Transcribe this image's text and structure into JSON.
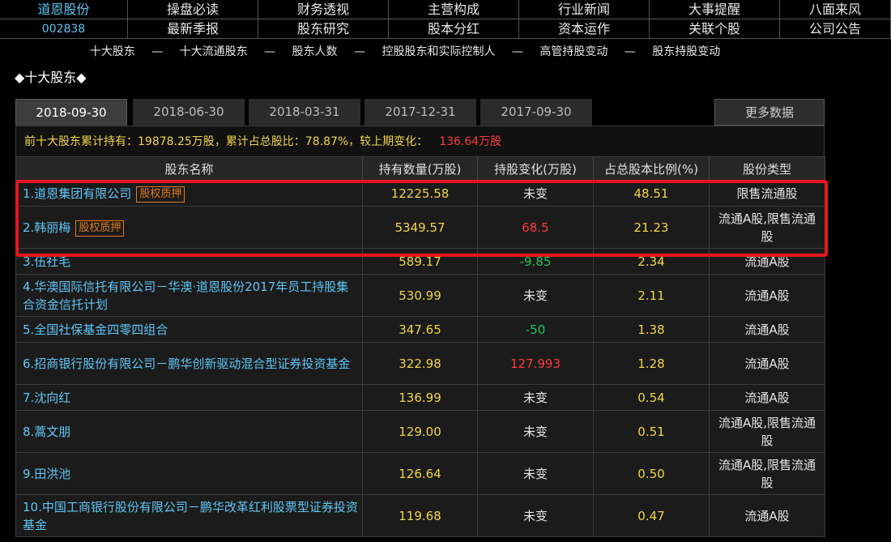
{
  "stock": {
    "name": "道恩股份",
    "code": "002838"
  },
  "topnav": {
    "row1": [
      "操盘必读",
      "财务透视",
      "主营构成",
      "行业新闻",
      "大事提醒",
      "八面来风"
    ],
    "row2": [
      "最新季报",
      "股东研究",
      "股本分红",
      "资本运作",
      "关联个股",
      "公司公告"
    ]
  },
  "subnav": [
    "十大股东",
    "十大流通股东",
    "股东人数",
    "控股股东和实际控制人",
    "高管持股变动",
    "股东持股变动"
  ],
  "subnav_sep": "—",
  "section_title": "◆十大股东◆",
  "tabs": [
    "2018-09-30",
    "2018-06-30",
    "2018-03-31",
    "2017-12-31",
    "2017-09-30"
  ],
  "more_label": "更多数据",
  "summary": {
    "text": "前十大股东累计持有：19878.25万股，累计占总股比：78.87%，较上期变化：",
    "change": "136.64万股"
  },
  "columns": [
    "股东名称",
    "持有数量(万股)",
    "持股变化(万股)",
    "占总股本比例(%)",
    "股份类型"
  ],
  "pledge_label": "股权质押",
  "rows": [
    {
      "name": "1.道恩集团有限公司",
      "pledge": true,
      "qty": "12225.58",
      "change": "未变",
      "dir": "same",
      "ratio": "48.51",
      "type": "限售流通股"
    },
    {
      "name": "2.韩丽梅",
      "pledge": true,
      "qty": "5349.57",
      "change": "68.5",
      "dir": "up",
      "ratio": "21.23",
      "type": "流通A股,限售流通股"
    },
    {
      "name": "3.伍社毛",
      "pledge": false,
      "qty": "589.17",
      "change": "-9.85",
      "dir": "down",
      "ratio": "2.34",
      "type": "流通A股"
    },
    {
      "name": "4.华澳国际信托有限公司－华澳·道恩股份2017年员工持股集合资金信托计划",
      "pledge": false,
      "qty": "530.99",
      "change": "未变",
      "dir": "same",
      "ratio": "2.11",
      "type": "流通A股"
    },
    {
      "name": "5.全国社保基金四零四组合",
      "pledge": false,
      "qty": "347.65",
      "change": "-50",
      "dir": "down",
      "ratio": "1.38",
      "type": "流通A股"
    },
    {
      "name": "6.招商银行股份有限公司－鹏华创新驱动混合型证券投资基金",
      "pledge": false,
      "qty": "322.98",
      "change": "127.993",
      "dir": "up",
      "ratio": "1.28",
      "type": "流通A股"
    },
    {
      "name": "7.沈向红",
      "pledge": false,
      "qty": "136.99",
      "change": "未变",
      "dir": "same",
      "ratio": "0.54",
      "type": "流通A股"
    },
    {
      "name": "8.蒿文朋",
      "pledge": false,
      "qty": "129.00",
      "change": "未变",
      "dir": "same",
      "ratio": "0.51",
      "type": "流通A股,限售流通股"
    },
    {
      "name": "9.田洪池",
      "pledge": false,
      "qty": "126.64",
      "change": "未变",
      "dir": "same",
      "ratio": "0.50",
      "type": "流通A股,限售流通股"
    },
    {
      "name": "10.中国工商银行股份有限公司－鹏华改革红利股票型证券投资基金",
      "pledge": false,
      "qty": "119.68",
      "change": "未变",
      "dir": "same",
      "ratio": "0.47",
      "type": "流通A股"
    }
  ],
  "colors": {
    "accent_blue": "#5fc6f5",
    "value_yellow": "#f0d54a",
    "up_red": "#ff3b3b",
    "down_green": "#22c55e",
    "pledge_orange": "#e07a1f",
    "highlight_red": "#e8151d"
  }
}
